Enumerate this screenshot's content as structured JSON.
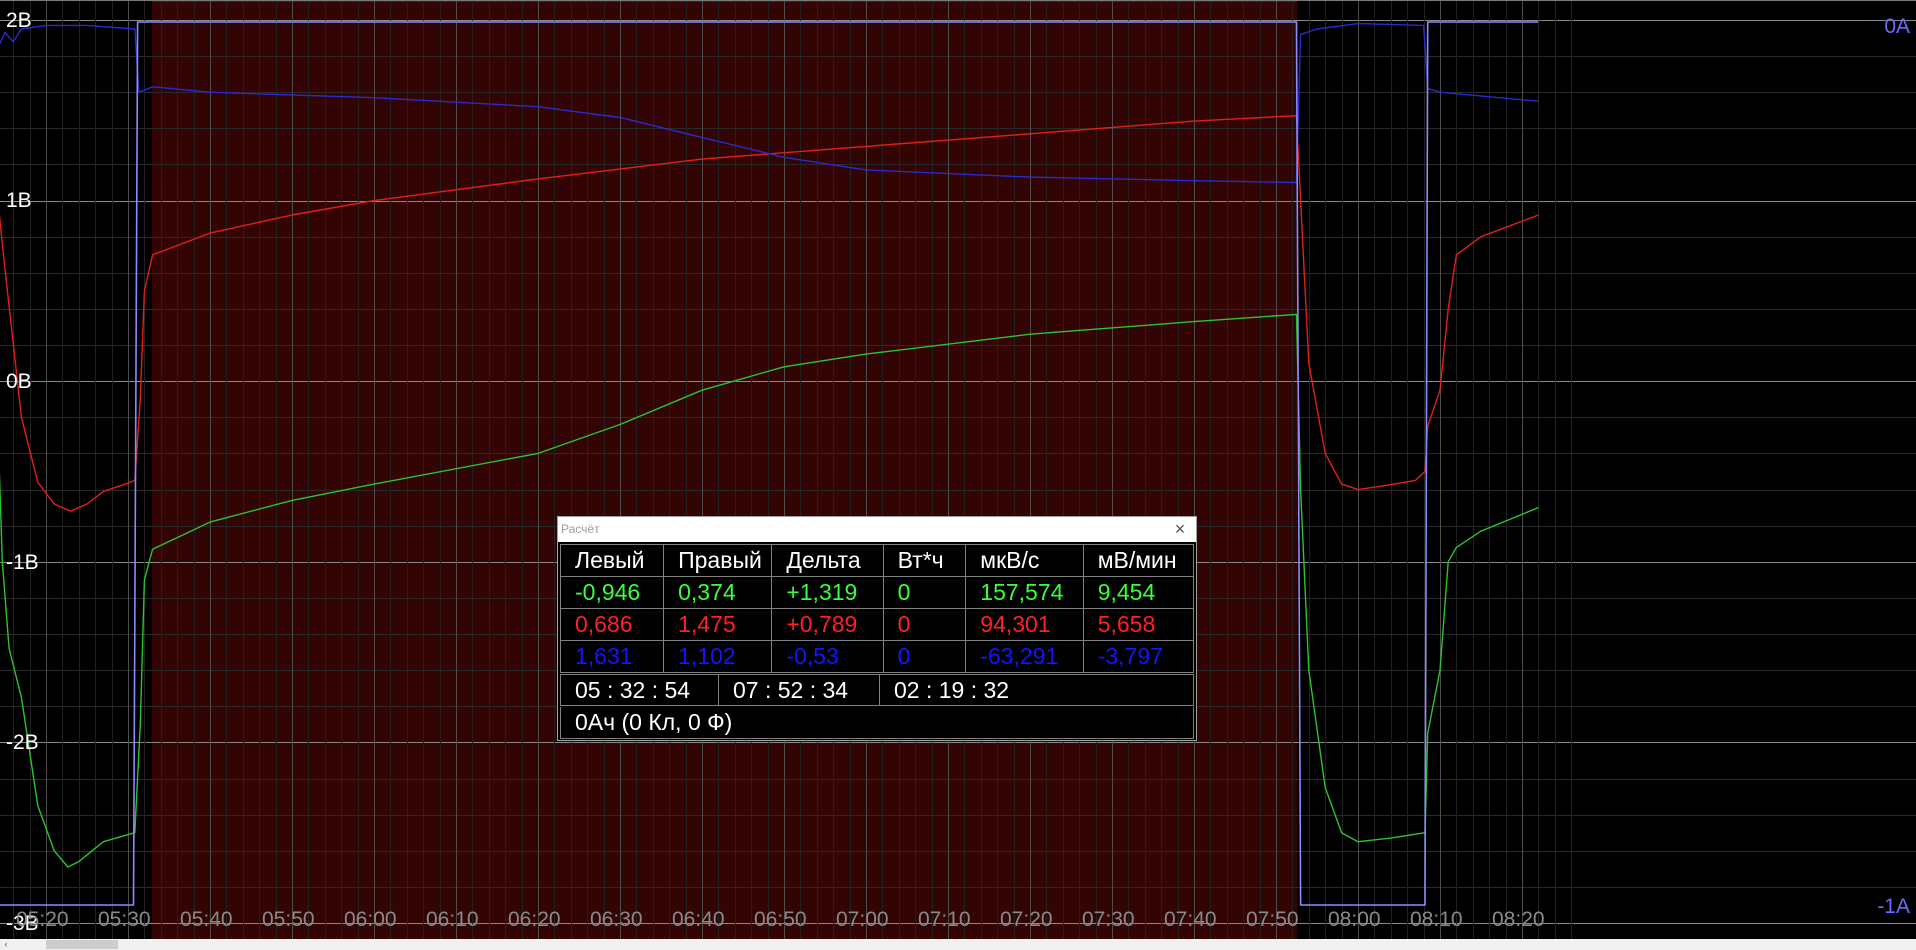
{
  "chart_data": {
    "type": "line",
    "y_axis_left": {
      "ticks": [
        "2В",
        "1В",
        "0В",
        "-1В",
        "-2В",
        "-3В"
      ],
      "range": [
        -3,
        2
      ],
      "unit": "В"
    },
    "y_axis_right": {
      "ticks": [
        "0А",
        "-1А"
      ],
      "range": [
        -1,
        0
      ],
      "unit": "А"
    },
    "x_axis": {
      "ticks": [
        "05:20",
        "05:30",
        "05:40",
        "05:50",
        "06:00",
        "06:10",
        "06:20",
        "06:30",
        "06:40",
        "06:50",
        "07:00",
        "07:10",
        "07:20",
        "07:30",
        "07:40",
        "07:50",
        "08:00",
        "08:10",
        "08:20"
      ]
    },
    "highlight_range": [
      "05:32:54",
      "07:52:34"
    ],
    "grid": true,
    "series": [
      {
        "color": "#e0201a",
        "points": [
          [
            "05:13:40",
            1.2
          ],
          [
            "05:15:00",
            0.62
          ],
          [
            "05:17:00",
            -0.2
          ],
          [
            "05:19:00",
            -0.56
          ],
          [
            "05:21:00",
            -0.68
          ],
          [
            "05:23:00",
            -0.72
          ],
          [
            "05:25:00",
            -0.68
          ],
          [
            "05:27:00",
            -0.61
          ],
          [
            "05:29:00",
            -0.58
          ],
          [
            "05:30:50",
            -0.55
          ],
          [
            "05:31:30",
            -0.1
          ],
          [
            "05:32:00",
            0.5
          ],
          [
            "05:33:00",
            0.7
          ],
          [
            "05:40:00",
            0.82
          ],
          [
            "05:50:00",
            0.92
          ],
          [
            "06:00:00",
            1.0
          ],
          [
            "06:20:00",
            1.12
          ],
          [
            "06:40:00",
            1.23
          ],
          [
            "07:00:00",
            1.3
          ],
          [
            "07:20:00",
            1.37
          ],
          [
            "07:40:00",
            1.44
          ],
          [
            "07:52:30",
            1.47
          ],
          [
            "07:53:00",
            1.0
          ],
          [
            "07:54:00",
            0.1
          ],
          [
            "07:56:00",
            -0.4
          ],
          [
            "07:58:00",
            -0.57
          ],
          [
            "08:00:00",
            -0.6
          ],
          [
            "08:03:00",
            -0.58
          ],
          [
            "08:07:00",
            -0.55
          ],
          [
            "08:08:10",
            -0.5
          ],
          [
            "08:08:30",
            -0.25
          ],
          [
            "08:10:00",
            -0.05
          ],
          [
            "08:11:00",
            0.4
          ],
          [
            "08:12:00",
            0.7
          ],
          [
            "08:15:00",
            0.8
          ],
          [
            "08:22:00",
            0.92
          ]
        ]
      },
      {
        "color": "#2bc42b",
        "points": [
          [
            "05:13:40",
            0.38
          ],
          [
            "05:14:40",
            -1.0
          ],
          [
            "05:15:30",
            -1.48
          ],
          [
            "05:17:00",
            -1.75
          ],
          [
            "05:19:00",
            -2.35
          ],
          [
            "05:21:00",
            -2.6
          ],
          [
            "05:22:40",
            -2.69
          ],
          [
            "05:24:00",
            -2.66
          ],
          [
            "05:27:00",
            -2.55
          ],
          [
            "05:30:50",
            -2.5
          ],
          [
            "05:31:30",
            -1.9
          ],
          [
            "05:32:00",
            -1.1
          ],
          [
            "05:33:00",
            -0.93
          ],
          [
            "05:40:00",
            -0.78
          ],
          [
            "05:50:00",
            -0.66
          ],
          [
            "06:00:00",
            -0.57
          ],
          [
            "06:20:00",
            -0.4
          ],
          [
            "06:30:00",
            -0.24
          ],
          [
            "06:40:00",
            -0.05
          ],
          [
            "06:50:00",
            0.08
          ],
          [
            "07:00:00",
            0.15
          ],
          [
            "07:20:00",
            0.26
          ],
          [
            "07:40:00",
            0.33
          ],
          [
            "07:52:30",
            0.37
          ],
          [
            "07:53:00",
            -0.6
          ],
          [
            "07:54:00",
            -1.6
          ],
          [
            "07:56:00",
            -2.25
          ],
          [
            "07:58:00",
            -2.5
          ],
          [
            "08:00:00",
            -2.55
          ],
          [
            "08:04:00",
            -2.53
          ],
          [
            "08:08:10",
            -2.5
          ],
          [
            "08:08:30",
            -1.95
          ],
          [
            "08:10:00",
            -1.6
          ],
          [
            "08:11:00",
            -1.0
          ],
          [
            "08:12:00",
            -0.92
          ],
          [
            "08:15:00",
            -0.83
          ],
          [
            "08:22:00",
            -0.7
          ]
        ]
      },
      {
        "color": "#2a2ad0",
        "points": [
          [
            "05:13:40",
            1.8
          ],
          [
            "05:15:00",
            1.93
          ],
          [
            "05:16:00",
            1.88
          ],
          [
            "05:17:00",
            1.95
          ],
          [
            "05:20:00",
            1.97
          ],
          [
            "05:25:00",
            1.97
          ],
          [
            "05:30:50",
            1.95
          ],
          [
            "05:31:20",
            1.6
          ],
          [
            "05:33:00",
            1.63
          ],
          [
            "05:40:00",
            1.6
          ],
          [
            "06:00:00",
            1.57
          ],
          [
            "06:20:00",
            1.52
          ],
          [
            "06:30:00",
            1.46
          ],
          [
            "06:40:00",
            1.35
          ],
          [
            "06:50:00",
            1.24
          ],
          [
            "07:00:00",
            1.17
          ],
          [
            "07:20:00",
            1.13
          ],
          [
            "07:40:00",
            1.11
          ],
          [
            "07:52:30",
            1.1
          ],
          [
            "07:53:00",
            1.92
          ],
          [
            "07:55:00",
            1.95
          ],
          [
            "08:00:00",
            1.98
          ],
          [
            "08:08:00",
            1.97
          ],
          [
            "08:08:30",
            1.62
          ],
          [
            "08:10:00",
            1.6
          ],
          [
            "08:22:00",
            1.55
          ]
        ]
      },
      {
        "color": "#8c8cff",
        "points": [
          [
            "05:13:20",
            0
          ],
          [
            "05:13:40",
            -1
          ],
          [
            "05:30:40",
            -1
          ],
          [
            "05:31:10",
            0
          ],
          [
            "07:52:30",
            0
          ],
          [
            "07:53:00",
            -1
          ],
          [
            "08:08:10",
            -1
          ],
          [
            "08:08:30",
            0
          ],
          [
            "08:22:00",
            0
          ]
        ]
      }
    ]
  },
  "dialog": {
    "title": "Расчёт",
    "header": [
      "Левый",
      "Правый",
      "Дельта",
      "Вт*ч",
      "мкВ/с",
      "мВ/мин"
    ],
    "rows": [
      {
        "color": "#39ff39",
        "cells": [
          "-0,946",
          "0,374",
          "+1,319",
          "0",
          "157,574",
          "9,454"
        ]
      },
      {
        "color": "#ff2020",
        "cells": [
          "0,686",
          "1,475",
          "+0,789",
          "0",
          "94,301",
          "5,658"
        ]
      },
      {
        "color": "#1414ff",
        "cells": [
          "1,631",
          "1,102",
          "-0,53",
          "0",
          "-63,291",
          "-3,797"
        ]
      }
    ],
    "times": [
      "05 : 32 : 54",
      "07 : 52 : 34",
      "02 : 19 : 32"
    ],
    "charge": "0Ач (0 Кл, 0 Ф)"
  }
}
